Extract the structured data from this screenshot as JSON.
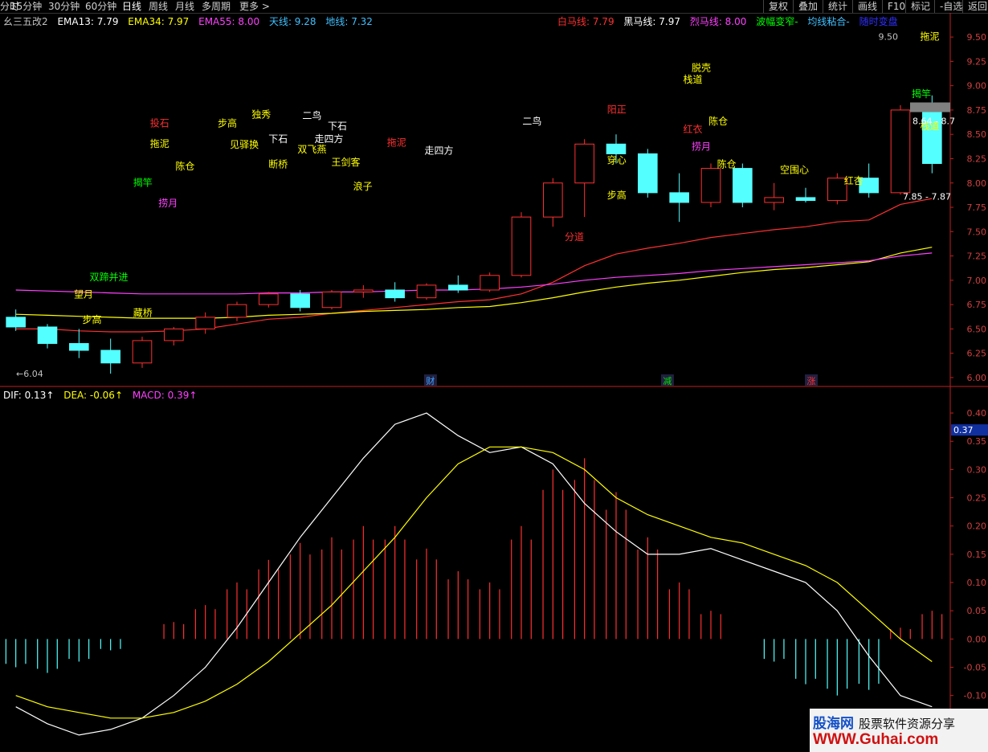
{
  "toolbar": {
    "items": [
      "分时",
      "15分钟",
      "30分钟",
      "60分钟",
      "日线",
      "周线",
      "月线",
      "多周期",
      "更多 >"
    ],
    "active": "日线",
    "right_items": [
      "复权",
      "叠加",
      "统计",
      "画线",
      "F10",
      "标记",
      "-自选",
      "返回"
    ]
  },
  "legend_main": [
    {
      "text": "幺三五改2",
      "color": "#c0c0c0"
    },
    {
      "text": "EMA13: 7.79",
      "color": "#ffffff"
    },
    {
      "text": "EMA34: 7.97",
      "color": "#ffff00"
    },
    {
      "text": "EMA55: 8.00",
      "color": "#ff40ff"
    },
    {
      "text": "天线: 9.28",
      "color": "#40c0ff"
    },
    {
      "text": "地线: 7.32",
      "color": "#40c0ff"
    }
  ],
  "legend_main_right": [
    {
      "text": "白马线: 7.79",
      "color": "#ff3030"
    },
    {
      "text": "黑马线: 7.97",
      "color": "#ffffff"
    },
    {
      "text": "烈马线: 8.00",
      "color": "#ff40ff"
    },
    {
      "text": "波幅变窄-",
      "color": "#00ff00"
    },
    {
      "text": "均线粘合-",
      "color": "#40c0ff"
    },
    {
      "text": "随时变盘",
      "color": "#3030ff"
    }
  ],
  "legend_macd": [
    {
      "text": "DIF: 0.13↑",
      "color": "#ffffff"
    },
    {
      "text": "DEA: -0.06↑",
      "color": "#ffff00"
    },
    {
      "text": "MACD: 0.39↑",
      "color": "#ff40ff"
    }
  ],
  "price_axis": {
    "ticks": [
      "9.50",
      "9.25",
      "9.00",
      "8.75",
      "8.50",
      "8.25",
      "8.00",
      "7.75",
      "7.50",
      "7.25",
      "7.00",
      "6.75",
      "6.50",
      "6.25",
      "6.00"
    ]
  },
  "macd_axis": {
    "ticks": [
      "0.40",
      "0.35",
      "0.30",
      "0.25",
      "0.20",
      "0.15",
      "0.10",
      "0.05",
      "0.00",
      "-0.05",
      "-0.10",
      "-0.15"
    ]
  },
  "price_tags": {
    "current": "0.37",
    "high_label": "9.50",
    "range_upper": "8.64 - 8.7",
    "range_lower": "7.85 - 7.87",
    "low_label": "6.04"
  },
  "event_markers": [
    {
      "text": "财",
      "color": "#40a0ff",
      "x": 24.5
    },
    {
      "text": "减",
      "color": "#00e000",
      "x": 38.5
    },
    {
      "text": "涨",
      "color": "#ff3030",
      "x": 47
    }
  ],
  "signal_labels": [
    {
      "text": "投石",
      "x": 8.5,
      "y": 8.58,
      "color": "#ff3030"
    },
    {
      "text": "拖泥",
      "x": 8.5,
      "y": 8.37,
      "color": "#ffff00"
    },
    {
      "text": "揭竿",
      "x": 7.5,
      "y": 7.97,
      "color": "#00ff00"
    },
    {
      "text": "捞月",
      "x": 9,
      "y": 7.76,
      "color": "#ff40ff"
    },
    {
      "text": "陈仓",
      "x": 10,
      "y": 8.14,
      "color": "#ffff00"
    },
    {
      "text": "步高",
      "x": 12.5,
      "y": 8.58,
      "color": "#ffff00"
    },
    {
      "text": "独秀",
      "x": 14.5,
      "y": 8.67,
      "color": "#ffff00"
    },
    {
      "text": "见驿换",
      "x": 13.5,
      "y": 8.36,
      "color": "#ffff00"
    },
    {
      "text": "下石",
      "x": 15.5,
      "y": 8.42,
      "color": "#ffffff"
    },
    {
      "text": "断桥",
      "x": 15.5,
      "y": 8.16,
      "color": "#ffff00"
    },
    {
      "text": "二鸟",
      "x": 17.5,
      "y": 8.66,
      "color": "#ffffff"
    },
    {
      "text": "双飞燕",
      "x": 17.5,
      "y": 8.31,
      "color": "#ffff00"
    },
    {
      "text": "下石",
      "x": 19,
      "y": 8.55,
      "color": "#ffffff"
    },
    {
      "text": "走四方",
      "x": 18.5,
      "y": 8.42,
      "color": "#ffffff"
    },
    {
      "text": "王剑客",
      "x": 19.5,
      "y": 8.18,
      "color": "#ffff00"
    },
    {
      "text": "浪子",
      "x": 20.5,
      "y": 7.93,
      "color": "#ffff00"
    },
    {
      "text": "拖泥",
      "x": 22.5,
      "y": 8.38,
      "color": "#ff3030"
    },
    {
      "text": "走四方",
      "x": 25,
      "y": 8.3,
      "color": "#ffffff"
    },
    {
      "text": "二鸟",
      "x": 30.5,
      "y": 8.6,
      "color": "#ffffff"
    },
    {
      "text": "阳正",
      "x": 35.5,
      "y": 8.72,
      "color": "#ff3030"
    },
    {
      "text": "穿心",
      "x": 35.5,
      "y": 8.2,
      "color": "#ffff00"
    },
    {
      "text": "步高",
      "x": 35.5,
      "y": 7.84,
      "color": "#ffff00"
    },
    {
      "text": "分道",
      "x": 33,
      "y": 7.41,
      "color": "#ff3030"
    },
    {
      "text": "脱壳",
      "x": 40.5,
      "y": 9.15,
      "color": "#ffff00"
    },
    {
      "text": "栈道",
      "x": 40,
      "y": 9.03,
      "color": "#ffff00"
    },
    {
      "text": "陈仓",
      "x": 41.5,
      "y": 8.6,
      "color": "#ffff00"
    },
    {
      "text": "红衣",
      "x": 40,
      "y": 8.52,
      "color": "#ff3030"
    },
    {
      "text": "捞月",
      "x": 40.5,
      "y": 8.34,
      "color": "#ff40ff"
    },
    {
      "text": "陈仓",
      "x": 42,
      "y": 8.16,
      "color": "#ffff00"
    },
    {
      "text": "空围心",
      "x": 46,
      "y": 8.1,
      "color": "#ffff00"
    },
    {
      "text": "红杏",
      "x": 49.5,
      "y": 7.99,
      "color": "#ffff00"
    },
    {
      "text": "拖泥",
      "x": 54,
      "y": 9.47,
      "color": "#ffff00"
    },
    {
      "text": "揭竿",
      "x": 53.5,
      "y": 8.88,
      "color": "#00ff00"
    },
    {
      "text": "栈道",
      "x": 54,
      "y": 8.55,
      "color": "#ffff00"
    },
    {
      "text": "望月",
      "x": 4,
      "y": 6.82,
      "color": "#ffff00"
    },
    {
      "text": "步高",
      "x": 4.5,
      "y": 6.56,
      "color": "#ffff00"
    },
    {
      "text": "双蹄并进",
      "x": 5.5,
      "y": 7.0,
      "color": "#00ff00"
    },
    {
      "text": "藏桥",
      "x": 7.5,
      "y": 6.63,
      "color": "#ffff00"
    }
  ],
  "chart_data": [
    {
      "type": "candlestick",
      "title": "幺三五改2",
      "ylim": [
        5.95,
        9.6
      ],
      "ohlc": [
        [
          6.62,
          6.7,
          6.48,
          6.52
        ],
        [
          6.52,
          6.55,
          6.3,
          6.35
        ],
        [
          6.35,
          6.5,
          6.2,
          6.28
        ],
        [
          6.28,
          6.4,
          6.04,
          6.15
        ],
        [
          6.15,
          6.42,
          6.1,
          6.38
        ],
        [
          6.38,
          6.52,
          6.33,
          6.5
        ],
        [
          6.5,
          6.67,
          6.45,
          6.62
        ],
        [
          6.62,
          6.78,
          6.58,
          6.75
        ],
        [
          6.75,
          6.88,
          6.72,
          6.86
        ],
        [
          6.86,
          6.9,
          6.68,
          6.72
        ],
        [
          6.72,
          6.9,
          6.7,
          6.88
        ],
        [
          6.88,
          6.95,
          6.82,
          6.9
        ],
        [
          6.9,
          6.98,
          6.78,
          6.82
        ],
        [
          6.82,
          6.97,
          6.8,
          6.95
        ],
        [
          6.95,
          7.05,
          6.87,
          6.9
        ],
        [
          6.9,
          7.08,
          6.88,
          7.05
        ],
        [
          7.05,
          7.7,
          7.03,
          7.65
        ],
        [
          7.65,
          8.05,
          7.55,
          8.0
        ],
        [
          8.0,
          8.45,
          7.65,
          8.4
        ],
        [
          8.4,
          8.5,
          8.2,
          8.3
        ],
        [
          8.3,
          8.35,
          7.85,
          7.9
        ],
        [
          7.9,
          8.1,
          7.6,
          7.8
        ],
        [
          7.8,
          8.2,
          7.75,
          8.15
        ],
        [
          8.15,
          8.2,
          7.75,
          7.8
        ],
        [
          7.8,
          8.0,
          7.72,
          7.85
        ],
        [
          7.85,
          7.95,
          7.8,
          7.82
        ],
        [
          7.82,
          8.1,
          7.78,
          8.05
        ],
        [
          8.05,
          8.2,
          7.85,
          7.9
        ],
        [
          7.9,
          8.8,
          7.88,
          8.75
        ],
        [
          8.75,
          8.9,
          8.1,
          8.2
        ]
      ],
      "up_color": "#ff3030",
      "down_color": "#54ffff",
      "series": [
        {
          "name": "EMA13",
          "values": [
            6.5,
            6.5,
            6.48,
            6.47,
            6.47,
            6.48,
            6.5,
            6.55,
            6.6,
            6.62,
            6.66,
            6.69,
            6.72,
            6.75,
            6.78,
            6.8,
            6.86,
            6.98,
            7.15,
            7.27,
            7.33,
            7.38,
            7.44,
            7.48,
            7.52,
            7.55,
            7.6,
            7.62,
            7.78,
            7.84
          ]
        },
        {
          "name": "EMA34",
          "values": [
            6.65,
            6.64,
            6.63,
            6.62,
            6.61,
            6.61,
            6.61,
            6.62,
            6.64,
            6.65,
            6.66,
            6.68,
            6.69,
            6.7,
            6.72,
            6.73,
            6.77,
            6.82,
            6.88,
            6.93,
            6.97,
            7.0,
            7.04,
            7.08,
            7.11,
            7.13,
            7.16,
            7.19,
            7.28,
            7.34
          ]
        },
        {
          "name": "EMA55",
          "values": [
            6.9,
            6.89,
            6.88,
            6.87,
            6.86,
            6.86,
            6.86,
            6.86,
            6.87,
            6.87,
            6.88,
            6.88,
            6.89,
            6.9,
            6.9,
            6.91,
            6.93,
            6.96,
            7.0,
            7.03,
            7.05,
            7.07,
            7.1,
            7.12,
            7.14,
            7.16,
            7.18,
            7.2,
            7.25,
            7.28
          ]
        }
      ]
    },
    {
      "type": "bar",
      "title": "MACD",
      "ylim": [
        -0.2,
        0.42
      ],
      "values": [
        -0.05,
        -0.06,
        -0.04,
        -0.02,
        0.0,
        0.03,
        0.06,
        0.1,
        0.14,
        0.17,
        0.18,
        0.2,
        0.2,
        0.16,
        0.12,
        0.1,
        0.2,
        0.3,
        0.32,
        0.26,
        0.18,
        0.1,
        0.05,
        0.0,
        -0.04,
        -0.08,
        -0.1,
        -0.09,
        0.02,
        0.05
      ],
      "series": [
        {
          "name": "DIF",
          "values": [
            -0.12,
            -0.15,
            -0.17,
            -0.16,
            -0.14,
            -0.1,
            -0.05,
            0.02,
            0.1,
            0.18,
            0.25,
            0.32,
            0.38,
            0.4,
            0.36,
            0.33,
            0.34,
            0.31,
            0.24,
            0.19,
            0.15,
            0.15,
            0.16,
            0.14,
            0.12,
            0.1,
            0.05,
            -0.03,
            -0.1,
            -0.12
          ]
        },
        {
          "name": "DEA",
          "values": [
            -0.1,
            -0.12,
            -0.13,
            -0.14,
            -0.14,
            -0.13,
            -0.11,
            -0.08,
            -0.04,
            0.01,
            0.06,
            0.12,
            0.18,
            0.25,
            0.31,
            0.34,
            0.34,
            0.33,
            0.3,
            0.25,
            0.22,
            0.2,
            0.18,
            0.17,
            0.15,
            0.13,
            0.1,
            0.05,
            0.0,
            -0.04
          ]
        }
      ]
    }
  ]
}
